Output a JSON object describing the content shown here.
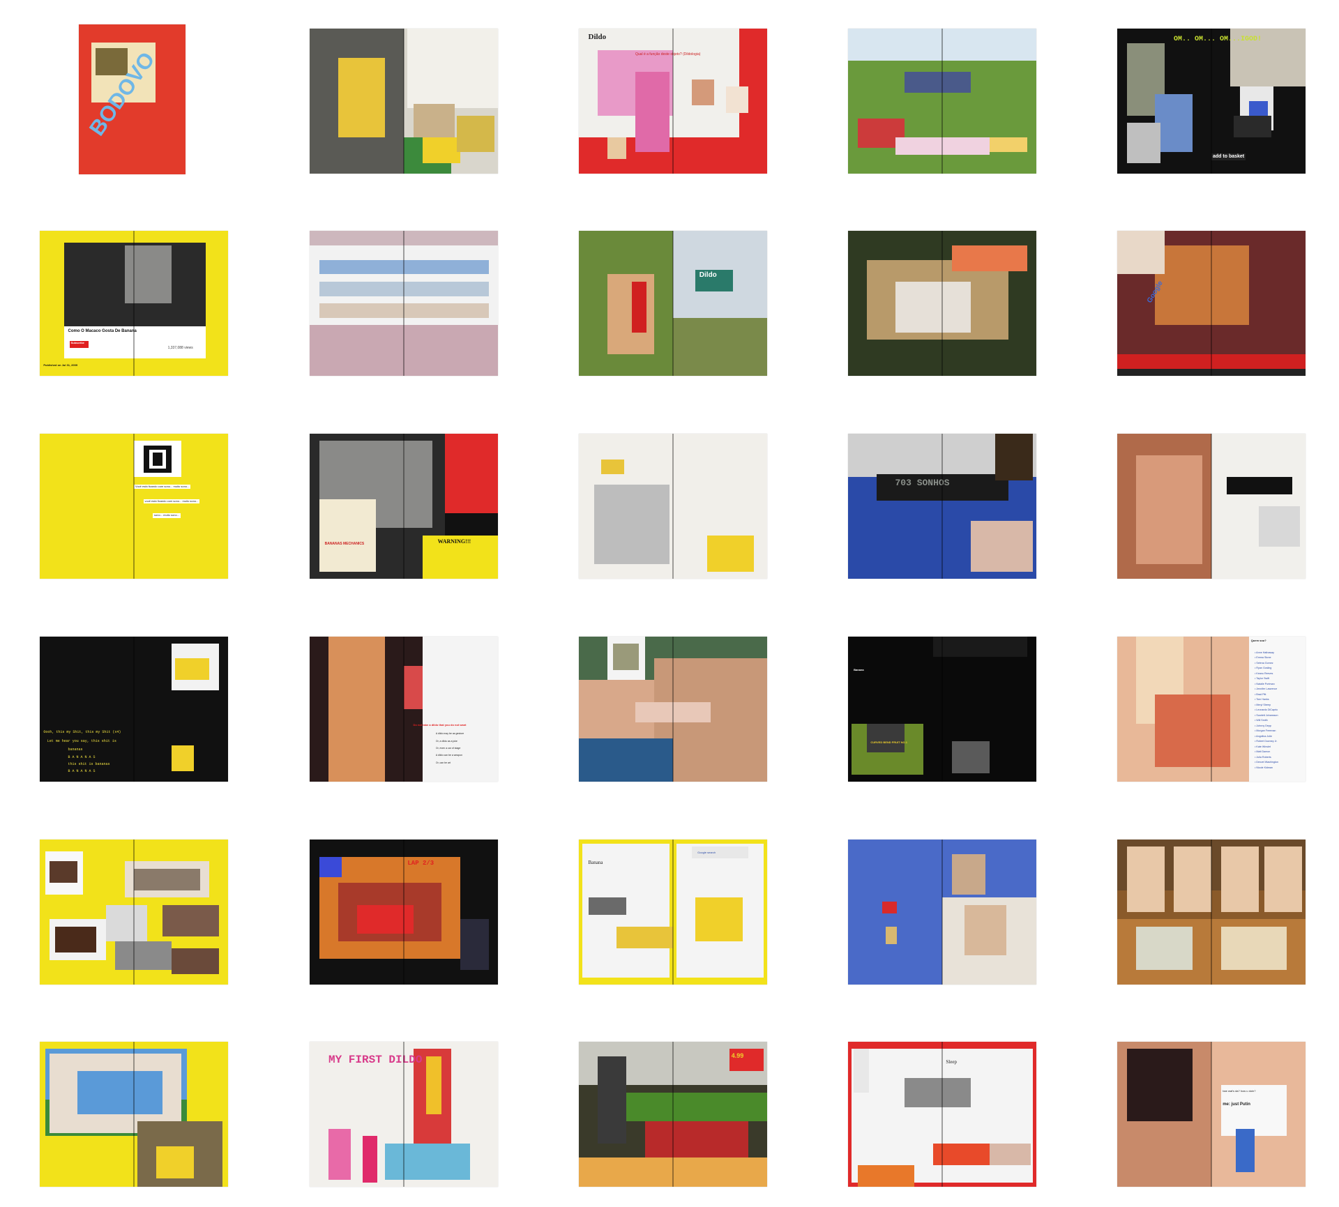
{
  "spreads": [
    {
      "id": "cover",
      "cover_title": "BODOVO"
    },
    {
      "id": "banana-table"
    },
    {
      "id": "dildo-wiki",
      "heading": "Dildo",
      "link_text": "Qual é a função deste objeto? (Dildologia)"
    },
    {
      "id": "grass-field"
    },
    {
      "id": "om-igod",
      "chant": "OM.. OM... OM...IGOD!",
      "basket_button": "add to basket"
    },
    {
      "id": "youtube",
      "video_title": "Como O Macaco Gosta De Banana",
      "subscribe": "Subscribe",
      "views": "1,337,088 views",
      "published": "Published on Jul 31, 2009"
    },
    {
      "id": "image-grid"
    },
    {
      "id": "road-sign",
      "sign_text": "Dildo"
    },
    {
      "id": "hammock"
    },
    {
      "id": "flowers-google",
      "logo": "Google"
    },
    {
      "id": "hypnosis",
      "caption_lines": [
        "Você está ficando com sono... muito sono...",
        "você está ficando com sono... muito sono...",
        "sono... muito sono..."
      ]
    },
    {
      "id": "xray",
      "warning": "WARNING!!!",
      "badge": "BANANAS MECHANICS"
    },
    {
      "id": "banana-text"
    },
    {
      "id": "bus",
      "destination": "703 SONHOS"
    },
    {
      "id": "woman-yellow"
    },
    {
      "id": "bananas-song",
      "lyrics": [
        "Oooh, this my Shit, this my Shit (x4)",
        "Let me hear you say, this shit is",
        "bananas",
        "B A N A N A S",
        "this shit is bananas",
        "B A N A N A S"
      ]
    },
    {
      "id": "dildo-costume",
      "heading": "Do not take a dildo that you do not want",
      "lines": [
        "A dildo may be as gesture",
        "Or, a dildo as a joke",
        "Or, even a car of stage",
        "A dildo can be a weapon",
        "Or, can be art"
      ]
    },
    {
      "id": "stone-faces"
    },
    {
      "id": "banana-dots",
      "label": "Banana",
      "sticker": "CURVED BEND FRUIT NO.1"
    },
    {
      "id": "hand-list",
      "title": "Quem sou?",
      "items": [
        "Anne Hathaway",
        "Emma Stone",
        "Selena Gomez",
        "Ryan Gosling",
        "Keanu Reeves",
        "Taylor Swift",
        "Natalie Portman",
        "Jennifer Lawrence",
        "Brad Pitt",
        "Tom Hanks",
        "Meryl Streep",
        "Leonardo DiCaprio",
        "Scarlett Johansson",
        "Will Smith",
        "Johnny Depp",
        "Morgan Freeman",
        "Angelina Jolie",
        "Robert Downey Jr.",
        "Kate Winslet",
        "Matt Damon",
        "Julia Roberts",
        "Denzel Washington",
        "Nicole Kidman"
      ]
    },
    {
      "id": "beds"
    },
    {
      "id": "racing-game",
      "lap": "LAP 2/3"
    },
    {
      "id": "banana-wiki",
      "heading": "Banana",
      "search_label": "Google search"
    },
    {
      "id": "wires"
    },
    {
      "id": "dwarfs"
    },
    {
      "id": "bone-fence"
    },
    {
      "id": "my-first-dildo",
      "title": "MY FIRST DILDO"
    },
    {
      "id": "supermarket",
      "price": "4.99"
    },
    {
      "id": "sleep-wiki",
      "heading": "Sleep"
    },
    {
      "id": "portrait",
      "question": "bae wat's da? how u doin?",
      "answer": "me: just Putin"
    }
  ]
}
